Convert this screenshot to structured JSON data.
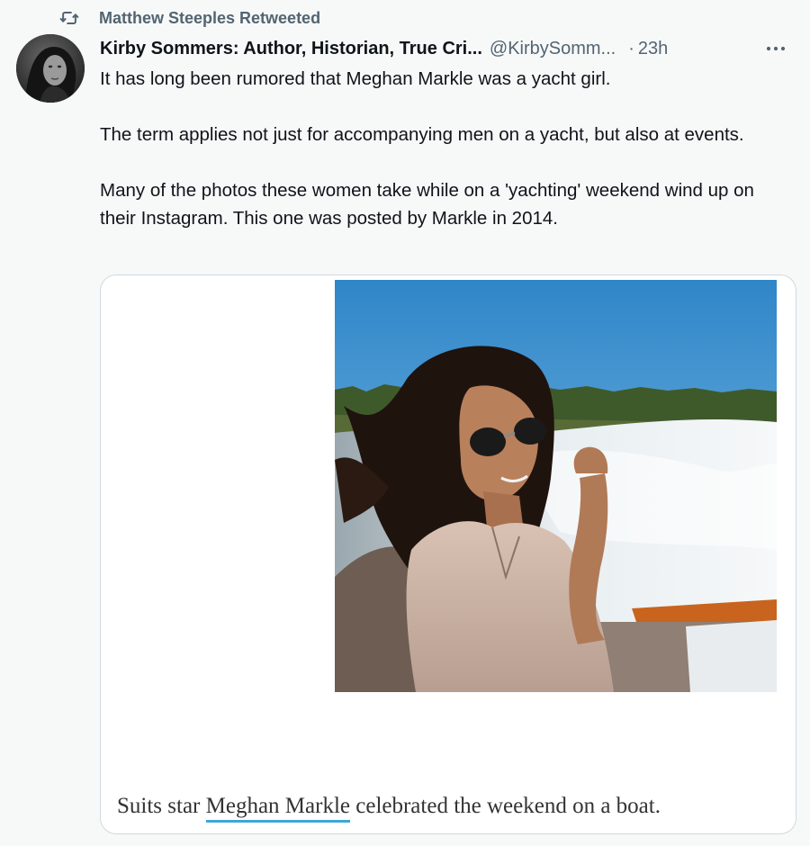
{
  "retweet": {
    "icon": "retweet-icon",
    "label": "Matthew Steeples Retweeted"
  },
  "author": {
    "display_name": "Kirby Sommers: Author, Historian, True Cri...",
    "handle": "@KirbySomm...",
    "separator": "·",
    "time": "23h",
    "more_icon": "more-horizontal-icon"
  },
  "tweet": {
    "paragraphs": [
      "It has long been rumored that Meghan Markle was a yacht girl.",
      "The term applies not just for accompanying men on a yacht, but also at events.",
      "Many of the photos these women take while on a 'yachting' weekend wind up on their Instagram. This one was posted by Markle in 2014."
    ]
  },
  "media": {
    "caption_prefix": "Suits star ",
    "caption_link": "Meghan Markle",
    "caption_suffix": " celebrated the weekend on a boat.",
    "link_underline_color": "#3ea6d8"
  },
  "colors": {
    "background": "#f7f9f9",
    "secondary_text": "#536471",
    "primary_text": "#0f1419",
    "card_border": "#cfd9de"
  }
}
